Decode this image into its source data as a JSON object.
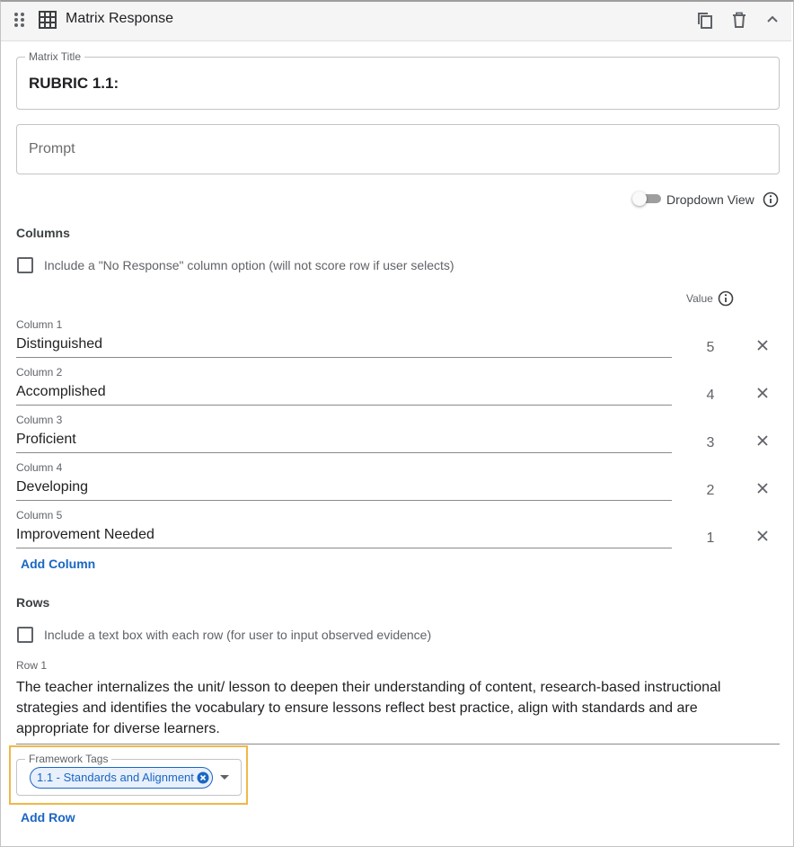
{
  "header": {
    "title": "Matrix Response",
    "icons": [
      "drag-handle-icon",
      "grid-icon",
      "copy-icon",
      "trash-icon",
      "chevron-up-icon"
    ]
  },
  "matrix_title": {
    "label": "Matrix Title",
    "value": "RUBRIC 1.1:"
  },
  "prompt": {
    "placeholder": "Prompt",
    "value": ""
  },
  "dropdown_view": {
    "label": "Dropdown View",
    "enabled": false
  },
  "columns_section": {
    "heading": "Columns",
    "no_response_label": "Include a \"No Response\" column option (will not score row if user selects)",
    "value_header": "Value",
    "items": [
      {
        "label": "Column 1",
        "value": "Distinguished",
        "score": "5"
      },
      {
        "label": "Column 2",
        "value": "Accomplished",
        "score": "4"
      },
      {
        "label": "Column 3",
        "value": "Proficient",
        "score": "3"
      },
      {
        "label": "Column 4",
        "value": "Developing",
        "score": "2"
      },
      {
        "label": "Column 5",
        "value": "Improvement Needed",
        "score": "1"
      }
    ],
    "add_label": "Add Column"
  },
  "rows_section": {
    "heading": "Rows",
    "textbox_label": "Include a text box with each row (for user to input observed evidence)",
    "row1_label": "Row 1",
    "row1_text": "The teacher internalizes the unit/ lesson to deepen their understanding of content, research-based instructional strategies and identifies the vocabulary to ensure lessons reflect best practice, align with standards and are appropriate for diverse learners.",
    "framework_label": "Framework Tags",
    "tag": "1.1 - Standards and Alignment",
    "add_label": "Add Row"
  },
  "colors": {
    "accent": "#1a66c4",
    "highlight": "#f0b84a"
  }
}
